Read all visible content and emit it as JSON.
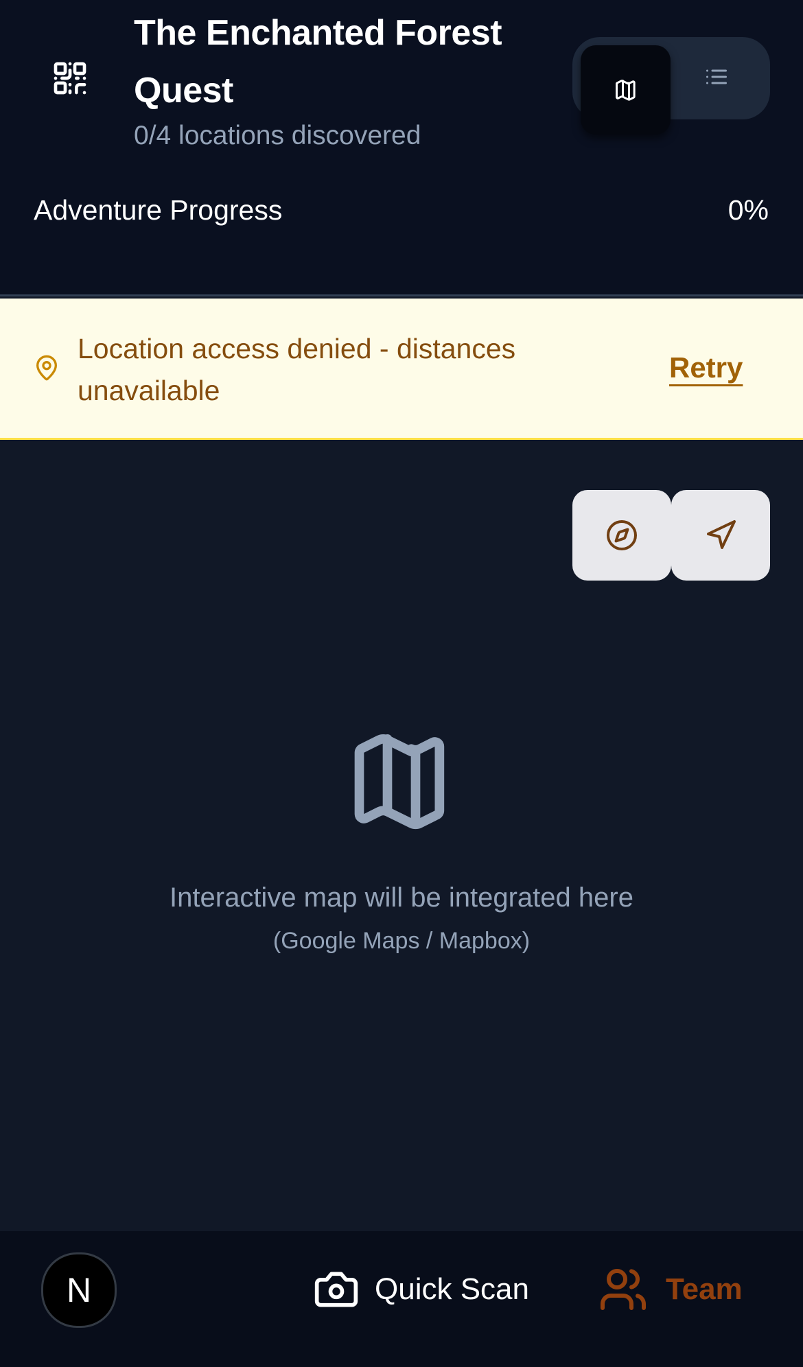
{
  "header": {
    "title": "The Enchanted Forest Quest",
    "subtitle": "0/4 locations discovered",
    "progress_label": "Adventure Progress",
    "progress_value": "0%",
    "progress_fraction": 0,
    "view_toggle": {
      "active": "map",
      "options": [
        "map-icon",
        "list-icon"
      ]
    }
  },
  "banner": {
    "message": "Location access denied - distances unavailable",
    "action_label": "Retry",
    "icon": "map-pin-icon"
  },
  "map": {
    "placeholder_main": "Interactive map will be integrated here",
    "placeholder_sub": "(Google Maps / Mapbox)",
    "controls": [
      "compass-icon",
      "navigation-icon"
    ]
  },
  "bottom_bar": {
    "avatar_letter": "N",
    "quick_scan_label": "Quick Scan",
    "team_label": "Team"
  },
  "colors": {
    "header_bg": "#0a1020",
    "page_bg": "#111827",
    "accent_amber": "#a16207",
    "banner_bg": "#fefce8",
    "muted_text": "#94a3b8"
  }
}
